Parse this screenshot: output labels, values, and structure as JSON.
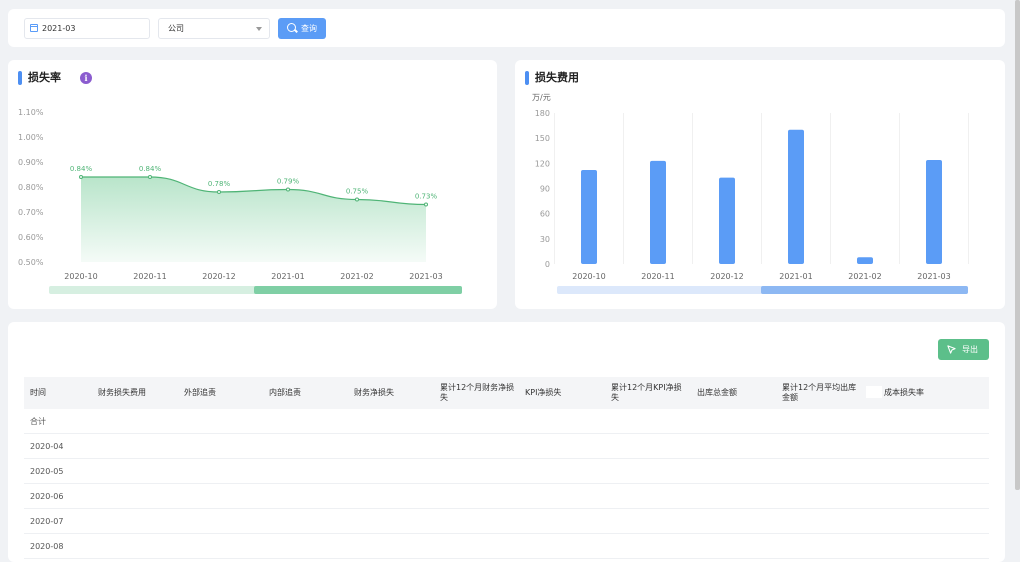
{
  "filters": {
    "date_value": "2021-03",
    "company_value": "公司",
    "query_label": "查询"
  },
  "loss_rate_card": {
    "title": "损失率",
    "info_icon": "i"
  },
  "loss_cost_card": {
    "title": "损失费用",
    "unit": "万/元"
  },
  "export_label": "导出",
  "table": {
    "columns": [
      "时间",
      "财务损失费用",
      "外部追责",
      "内部追责",
      "财务净损失",
      "累计12个月财务净损失",
      "KPI净损失",
      "累计12个月KPI净损失",
      "出库总金额",
      "累计12个月平均出库金额",
      "成本损失率"
    ],
    "rows": [
      "合计",
      "2020-04",
      "2020-05",
      "2020-06",
      "2020-07",
      "2020-08"
    ]
  },
  "colors": {
    "primary": "#5b9cf6",
    "green": "#5cbf8a",
    "info": "#8b5ccf"
  },
  "icons": [
    "calendar-icon",
    "chevron-down-icon",
    "search-icon",
    "info-icon",
    "export-icon"
  ],
  "chart_data": [
    {
      "type": "area",
      "title": "损失率",
      "categories": [
        "2020-10",
        "2020-11",
        "2020-12",
        "2021-01",
        "2021-02",
        "2021-03"
      ],
      "values": [
        0.84,
        0.84,
        0.78,
        0.79,
        0.75,
        0.73
      ],
      "value_labels": [
        "0.84%",
        "0.84%",
        "0.78%",
        "0.79%",
        "0.75%",
        "0.73%"
      ],
      "y_ticks": [
        "0.50%",
        "0.60%",
        "0.70%",
        "0.80%",
        "0.90%",
        "1.00%",
        "1.10%"
      ],
      "ylim": [
        0.5,
        1.1
      ],
      "grid": false,
      "slider": "bottom"
    },
    {
      "type": "bar",
      "title": "损失费用",
      "ylabel": "万/元",
      "categories": [
        "2020-10",
        "2020-11",
        "2020-12",
        "2021-01",
        "2021-02",
        "2021-03"
      ],
      "values": [
        112,
        123,
        103,
        160,
        8,
        124
      ],
      "y_ticks": [
        "0",
        "30",
        "60",
        "90",
        "120",
        "150",
        "180"
      ],
      "ylim": [
        0,
        180
      ],
      "grid": true,
      "slider": "bottom"
    }
  ]
}
